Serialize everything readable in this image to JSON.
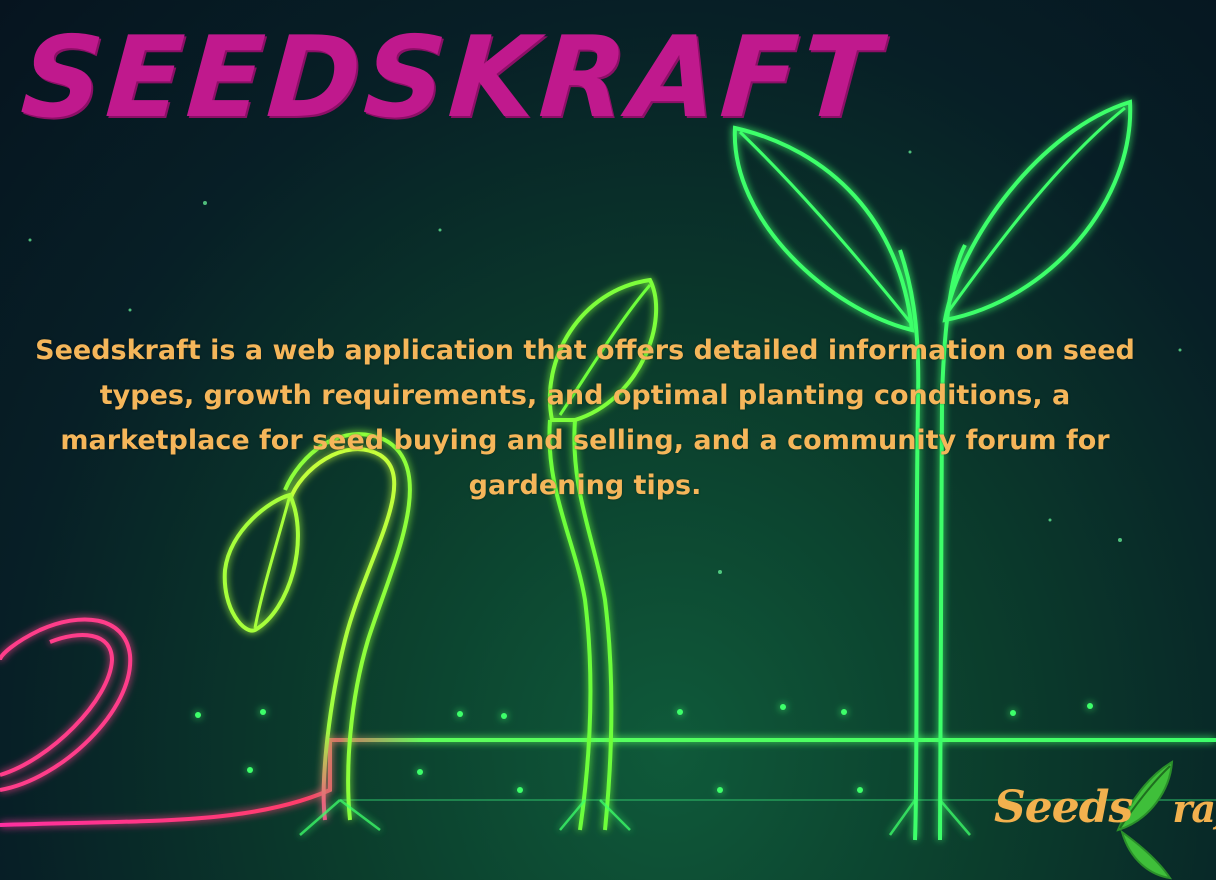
{
  "poster": {
    "title": "SEEDSKRAFT",
    "description": "Seedskraft is a web application that offers detailed information on seed types, growth requirements, and optimal planting conditions, a marketplace for seed buying and selling, and a community forum for gardening tips."
  },
  "logo": {
    "text_start": "Seeds",
    "text_end": "raft",
    "icon": "leaf-k-icon"
  },
  "colors": {
    "title": "#c0198d",
    "description": "#f5b65a",
    "sprout_glow": "#3dff6a",
    "seed_glow": "#ff3d9a",
    "logo_text": "#f2b14e"
  }
}
